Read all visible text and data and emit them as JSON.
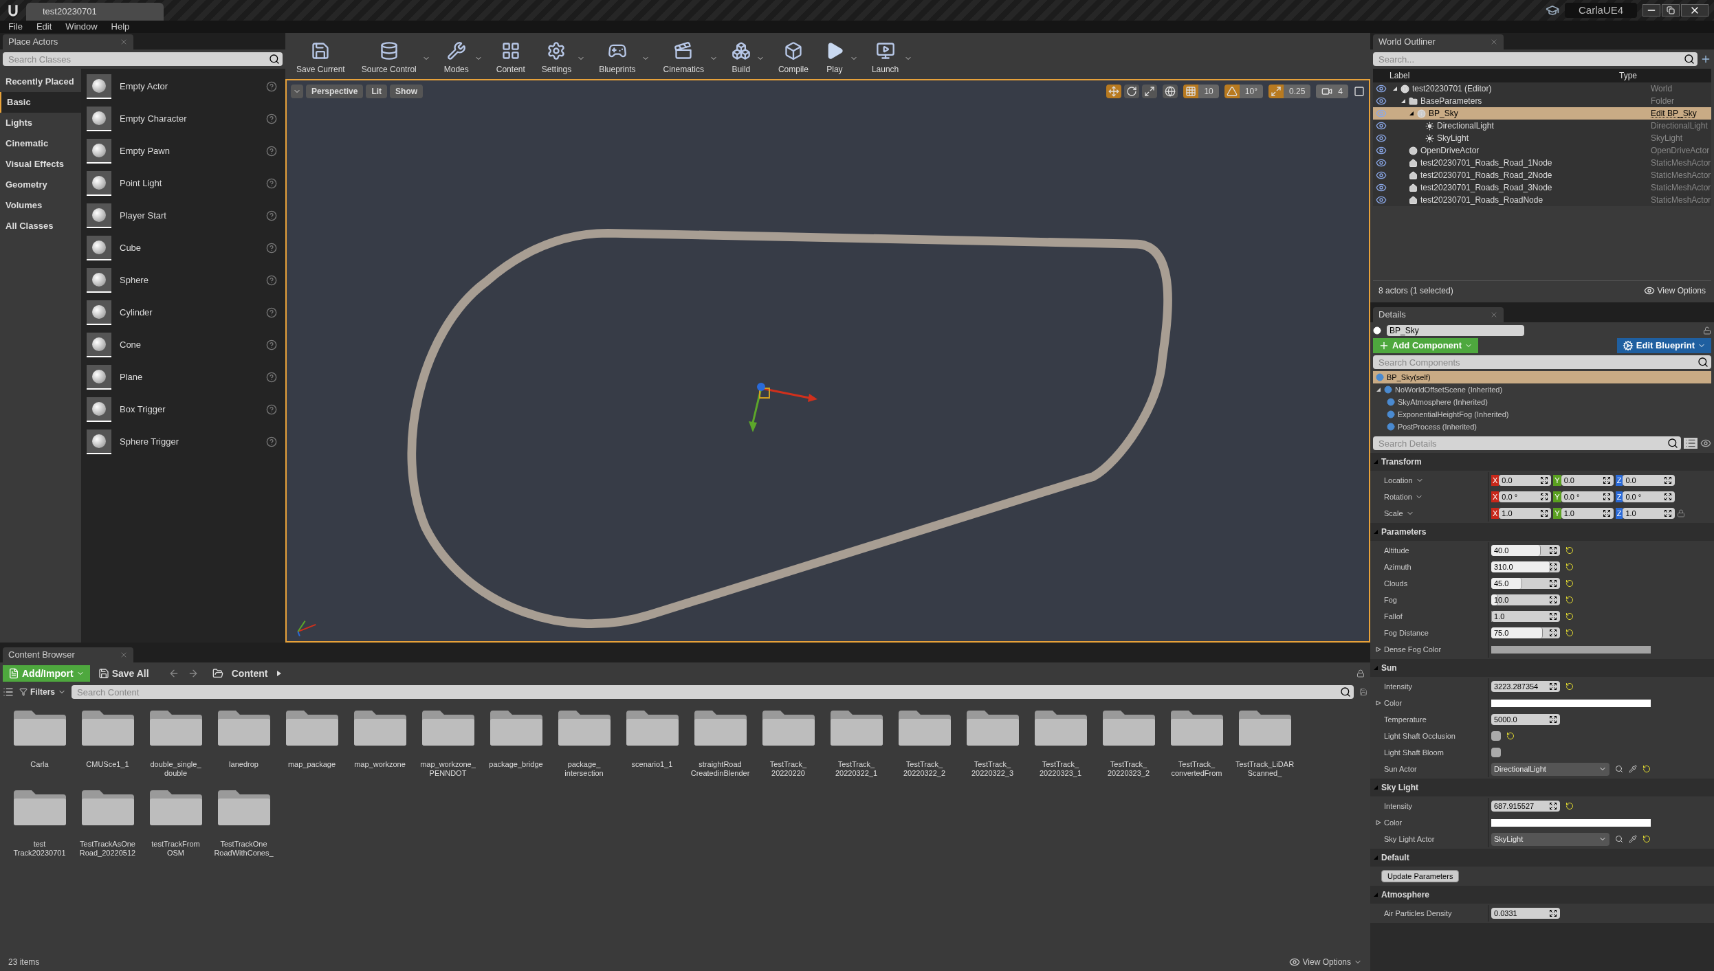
{
  "title_bar": {
    "tab": "test20230701",
    "project": "CarlaUE4"
  },
  "menu": [
    "File",
    "Edit",
    "Window",
    "Help"
  ],
  "place_actors": {
    "tab": "Place Actors",
    "search": {
      "placeholder": "Search Classes"
    },
    "categories": [
      {
        "label": "Recently Placed",
        "selected": false
      },
      {
        "label": "Basic",
        "selected": true
      },
      {
        "label": "Lights",
        "selected": false
      },
      {
        "label": "Cinematic",
        "selected": false
      },
      {
        "label": "Visual Effects",
        "selected": false
      },
      {
        "label": "Geometry",
        "selected": false
      },
      {
        "label": "Volumes",
        "selected": false
      },
      {
        "label": "All Classes",
        "selected": false
      }
    ],
    "items": [
      "Empty Actor",
      "Empty Character",
      "Empty Pawn",
      "Point Light",
      "Player Start",
      "Cube",
      "Sphere",
      "Cylinder",
      "Cone",
      "Plane",
      "Box Trigger",
      "Sphere Trigger"
    ]
  },
  "toolbar": [
    {
      "label": "Save Current",
      "dropdown": false
    },
    {
      "label": "Source Control",
      "dropdown": true
    },
    {
      "label": "Modes",
      "dropdown": true
    },
    {
      "label": "Content",
      "dropdown": false
    },
    {
      "label": "Settings",
      "dropdown": true
    },
    {
      "label": "Blueprints",
      "dropdown": true
    },
    {
      "label": "Cinematics",
      "dropdown": true
    },
    {
      "label": "Build",
      "dropdown": true
    },
    {
      "label": "Compile",
      "dropdown": false
    },
    {
      "label": "Play",
      "dropdown": true
    },
    {
      "label": "Launch",
      "dropdown": true
    }
  ],
  "viewport": {
    "view_buttons": [
      "Perspective",
      "Lit",
      "Show"
    ],
    "transform_modes": [
      {
        "selected": true
      },
      {
        "selected": false
      },
      {
        "selected": false
      }
    ],
    "snaps": [
      {
        "value": "10",
        "on": true
      },
      {
        "value": "10°",
        "on": true
      },
      {
        "value": "0.25",
        "on": true
      }
    ],
    "camera_speed": "4"
  },
  "world_outliner": {
    "tab": "World Outliner",
    "search": {
      "placeholder": "Search..."
    },
    "columns": [
      "Label",
      "Type"
    ],
    "rows": [
      {
        "label": "test20230701 (Editor)",
        "type": "World",
        "kind": "world",
        "selected": false,
        "expanded": true,
        "children": [
          {
            "label": "BaseParameters",
            "type": "Folder",
            "kind": "folder",
            "selected": false,
            "expanded": true,
            "children": [
              {
                "label": "BP_Sky",
                "type": "Edit BP_Sky",
                "kind": "blueprint",
                "selected": true,
                "expanded": true,
                "children": [
                  {
                    "label": "DirectionalLight",
                    "type": "DirectionalLight",
                    "kind": "light",
                    "selected": false
                  },
                  {
                    "label": "SkyLight",
                    "type": "SkyLight",
                    "kind": "light",
                    "selected": false
                  }
                ]
              }
            ]
          },
          {
            "label": "OpenDriveActor",
            "type": "OpenDriveActor",
            "kind": "actor",
            "selected": false
          },
          {
            "label": "test20230701_Roads_Road_1Node",
            "type": "StaticMeshActor",
            "kind": "mesh",
            "selected": false
          },
          {
            "label": "test20230701_Roads_Road_2Node",
            "type": "StaticMeshActor",
            "kind": "mesh",
            "selected": false
          },
          {
            "label": "test20230701_Roads_Road_3Node",
            "type": "StaticMeshActor",
            "kind": "mesh",
            "selected": false
          },
          {
            "label": "test20230701_Roads_RoadNode",
            "type": "StaticMeshActor",
            "kind": "mesh",
            "selected": false
          }
        ]
      }
    ],
    "status": "8 actors (1 selected)",
    "view_options": "View Options"
  },
  "details": {
    "tab": "Details",
    "name": "BP_Sky",
    "add_component": "Add Component",
    "edit_blueprint": "Edit Blueprint",
    "search_components": {
      "placeholder": "Search Components"
    },
    "components": [
      {
        "label": "BP_Sky(self)",
        "selected": true
      },
      {
        "label": "NoWorldOffsetScene (Inherited)",
        "selected": false,
        "expanded": true,
        "children": [
          {
            "label": "SkyAtmosphere (Inherited)",
            "selected": false
          },
          {
            "label": "ExponentialHeightFog (Inherited)",
            "selected": false
          },
          {
            "label": "PostProcess (Inherited)",
            "selected": false
          }
        ]
      }
    ],
    "search_details": {
      "placeholder": "Search Details"
    },
    "sections": [
      {
        "title": "Transform",
        "rows": [
          {
            "kind": "vector",
            "label": "Location",
            "axes": [
              "X",
              "Y",
              "Z"
            ],
            "values": [
              "0.0",
              "0.0",
              "0.0"
            ],
            "lock": false
          },
          {
            "kind": "vector",
            "label": "Rotation",
            "axes": [
              "X",
              "Y",
              "Z"
            ],
            "values": [
              "0.0 °",
              "0.0 °",
              "0.0 °"
            ],
            "lock": false
          },
          {
            "kind": "vector",
            "label": "Scale",
            "axes": [
              "X",
              "Y",
              "Z"
            ],
            "values": [
              "1.0",
              "1.0",
              "1.0"
            ],
            "lock": true
          }
        ]
      },
      {
        "title": "Parameters",
        "rows": [
          {
            "kind": "slider",
            "label": "Altitude",
            "value": "40.0",
            "level": 0.72,
            "reset": true
          },
          {
            "kind": "slider",
            "label": "Azimuth",
            "value": "310.0",
            "level": 0.86,
            "reset": true
          },
          {
            "kind": "slider",
            "label": "Clouds",
            "value": "45.0",
            "level": 0.45,
            "reset": true
          },
          {
            "kind": "slider",
            "label": "Fog",
            "value": "10.0",
            "level": 0.1,
            "reset": true
          },
          {
            "kind": "slider",
            "label": "Fallof",
            "value": "1.0",
            "level": 0.0,
            "reset": true
          },
          {
            "kind": "slider",
            "label": "Fog Distance",
            "value": "75.0",
            "level": 0.75,
            "reset": true
          },
          {
            "kind": "color",
            "label": "Dense Fog Color",
            "color": "#a3a3a3"
          }
        ]
      },
      {
        "title": "Sun",
        "rows": [
          {
            "kind": "number",
            "label": "Intensity",
            "value": "3223.287354",
            "reset": true
          },
          {
            "kind": "color",
            "label": "Color",
            "color": "#ffffff"
          },
          {
            "kind": "number",
            "label": "Temperature",
            "value": "5000.0",
            "reset": false
          },
          {
            "kind": "checkbox",
            "label": "Light Shaft Occlusion",
            "checked": false,
            "reset": true
          },
          {
            "kind": "checkbox",
            "label": "Light Shaft Bloom",
            "checked": false,
            "reset": false
          },
          {
            "kind": "actor",
            "label": "Sun Actor",
            "value": "DirectionalLight",
            "reset": true
          }
        ]
      },
      {
        "title": "Sky Light",
        "rows": [
          {
            "kind": "number",
            "label": "Intensity",
            "value": "687.915527",
            "reset": true
          },
          {
            "kind": "color",
            "label": "Color",
            "color": "#ffffff"
          },
          {
            "kind": "actor",
            "label": "Sky Light Actor",
            "value": "SkyLight",
            "reset": true
          }
        ]
      },
      {
        "title": "Default",
        "rows": [
          {
            "kind": "button",
            "label": "Update Parameters"
          }
        ]
      },
      {
        "title": "Atmosphere",
        "rows": [
          {
            "kind": "number",
            "label": "Air Particles Density",
            "value": "0.0331",
            "reset": false
          }
        ]
      }
    ]
  },
  "content_browser": {
    "tab": "Content Browser",
    "add_import": "Add/Import",
    "save_all": "Save All",
    "path": "Content",
    "filters": "Filters",
    "search": {
      "placeholder": "Search Content"
    },
    "folders": [
      "Carla",
      "CMUSce1_1",
      "double_single_\ndouble",
      "lanedrop",
      "map_package",
      "map_workzone",
      "map_workzone_\nPENNDOT",
      "package_bridge",
      "package_\nintersection",
      "scenario1_1",
      "straightRoad\nCreatedinBlender",
      "TestTrack_\n20220220",
      "TestTrack_\n20220322_1",
      "TestTrack_\n20220322_2",
      "TestTrack_\n20220322_3",
      "TestTrack_\n20220323_1",
      "TestTrack_\n20220323_2",
      "TestTrack_\nconvertedFrom",
      "TestTrack_LiDAR\nScanned_",
      "test\nTrack20230701",
      "TestTrackAsOne\nRoad_20220512",
      "testTrackFrom\nOSM",
      "TestTrackOne\nRoadWithCones_"
    ],
    "count": "23 items",
    "view_options": "View Options"
  }
}
